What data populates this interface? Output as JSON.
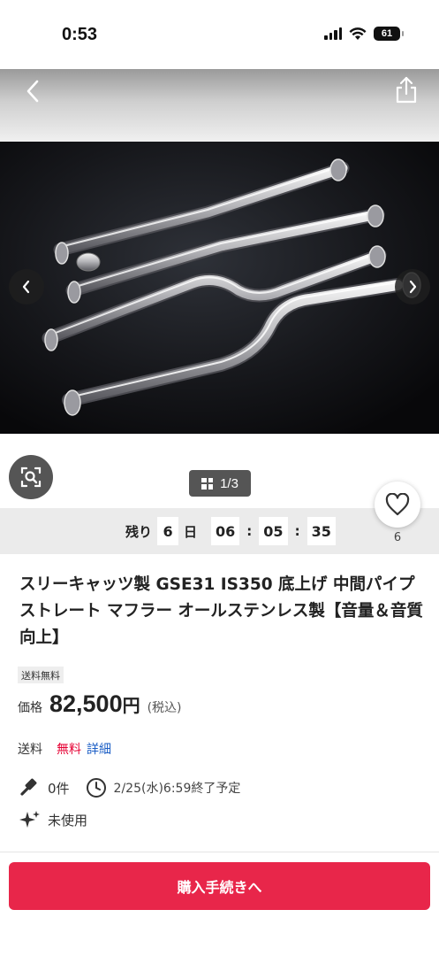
{
  "status": {
    "time": "0:53",
    "battery": "61"
  },
  "gallery": {
    "page": "1/3"
  },
  "countdown": {
    "label": "残り",
    "days": "6",
    "day_unit": "日",
    "hours": "06",
    "minutes": "05",
    "seconds": "35",
    "sep": ":"
  },
  "likes": {
    "count": "6"
  },
  "product": {
    "title": "スリーキャッツ製 GSE31 IS350 底上げ 中間パイプ ストレート マフラー オールステンレス製【音量＆音質向上】",
    "badge": "送料無料",
    "price_label": "価格",
    "price": "82,500",
    "currency": "円",
    "tax_note": "(税込)",
    "shipping_label": "送料",
    "shipping_value": "無料",
    "shipping_detail": "詳細",
    "bids": "0件",
    "end_time": "2/25(水)6:59終了予定",
    "condition": "未使用"
  },
  "purchase_button": "購入手続きへ",
  "colors": {
    "accent": "#e8264a",
    "link": "#1a5dc5",
    "free": "#e60033"
  }
}
